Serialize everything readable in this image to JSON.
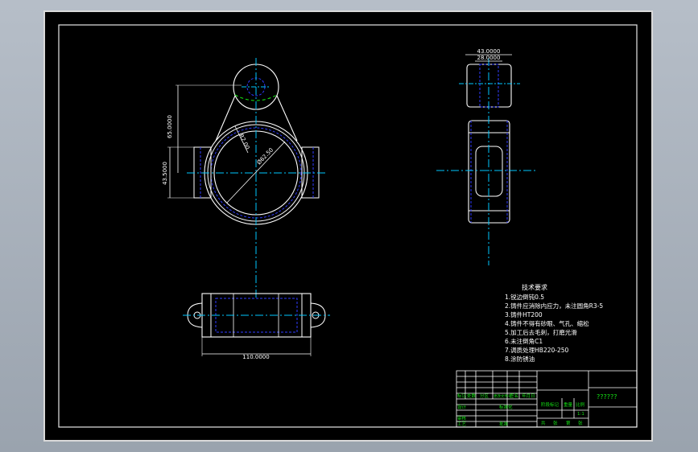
{
  "drawing": {
    "dim_top_width_outer": "43.0000",
    "dim_top_width_inner": "28.0000",
    "dim_height_left": "65.0000",
    "dim_bore_height": "43.5000",
    "dim_bottom_width": "110.0000",
    "dim_diameter": "Ø62.50",
    "dim_small_radius": "R2.00",
    "notes_title": "技术要求",
    "notes": [
      "1.锐边倒钝0.5",
      "2.铸件应消除内应力，未注圆角R3-5",
      "3.铸件HT200",
      "4.铸件不得有砂眼、气孔、缩松",
      "5.加工后去毛刺，打磨光滑",
      "6.未注倒角C1",
      "7.调质处理HB220-250",
      "8.涂防锈油"
    ]
  },
  "title_block": {
    "drawing_name": "??????",
    "cell_labels": [
      "标记",
      "处数",
      "分区",
      "更改文件号",
      "签名",
      "年月日",
      "设计",
      "标准化",
      "阶段标记",
      "重量",
      "比例",
      "审核",
      "工艺",
      "批准",
      "共",
      "张",
      "第",
      "张"
    ],
    "scale": "1:1"
  },
  "colors": {
    "sheet_bg": "#000000",
    "outline": "#ffffff",
    "hidden": "#2f3bff",
    "center": "#00c8ff",
    "dim": "#ffffff",
    "note_text": "#ffffff",
    "green": "#14e314"
  }
}
